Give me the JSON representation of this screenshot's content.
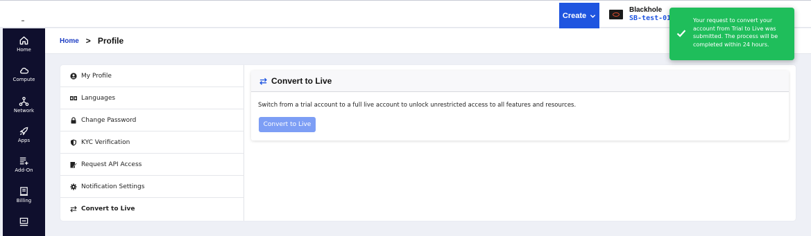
{
  "topbar": {
    "create_label": "Create",
    "account_name": "Blackhole",
    "account_id": "SB-test-01"
  },
  "sidebar": {
    "items": [
      {
        "label": "Home",
        "icon": "home-icon"
      },
      {
        "label": "Compute",
        "icon": "cloud-icon"
      },
      {
        "label": "Network",
        "icon": "network-icon"
      },
      {
        "label": "Apps",
        "icon": "rocket-icon"
      },
      {
        "label": "Add-On",
        "icon": "list-add-icon"
      },
      {
        "label": "Billing",
        "icon": "receipt-icon"
      },
      {
        "label": "",
        "icon": "support-icon"
      }
    ]
  },
  "breadcrumb": {
    "home": "Home",
    "separator": ">",
    "current": "Profile"
  },
  "menu": {
    "items": [
      {
        "label": "My Profile",
        "icon": "user-circle-icon"
      },
      {
        "label": "Languages",
        "icon": "language-icon"
      },
      {
        "label": "Change Password",
        "icon": "lock-icon"
      },
      {
        "label": "KYC Verification",
        "icon": "shield-icon"
      },
      {
        "label": "Request API Access",
        "icon": "pen-icon"
      },
      {
        "label": "Notification Settings",
        "icon": "gear-icon"
      },
      {
        "label": "Convert to Live",
        "icon": "swap-icon"
      }
    ]
  },
  "panel": {
    "title": "Convert to Live",
    "description": "Switch from a trial account to a full live account to unlock unrestricted access to all features and resources.",
    "button_label": "Convert to Live"
  },
  "toast": {
    "message": "Your request to convert your account from Trial to Live was submitted. The process will be completed within 24 hours."
  },
  "colors": {
    "brand_blue": "#1f55e0",
    "sidebar_bg": "#0f0f2d",
    "button_light": "#7d9ef5",
    "toast_green": "#1fbe5b"
  }
}
